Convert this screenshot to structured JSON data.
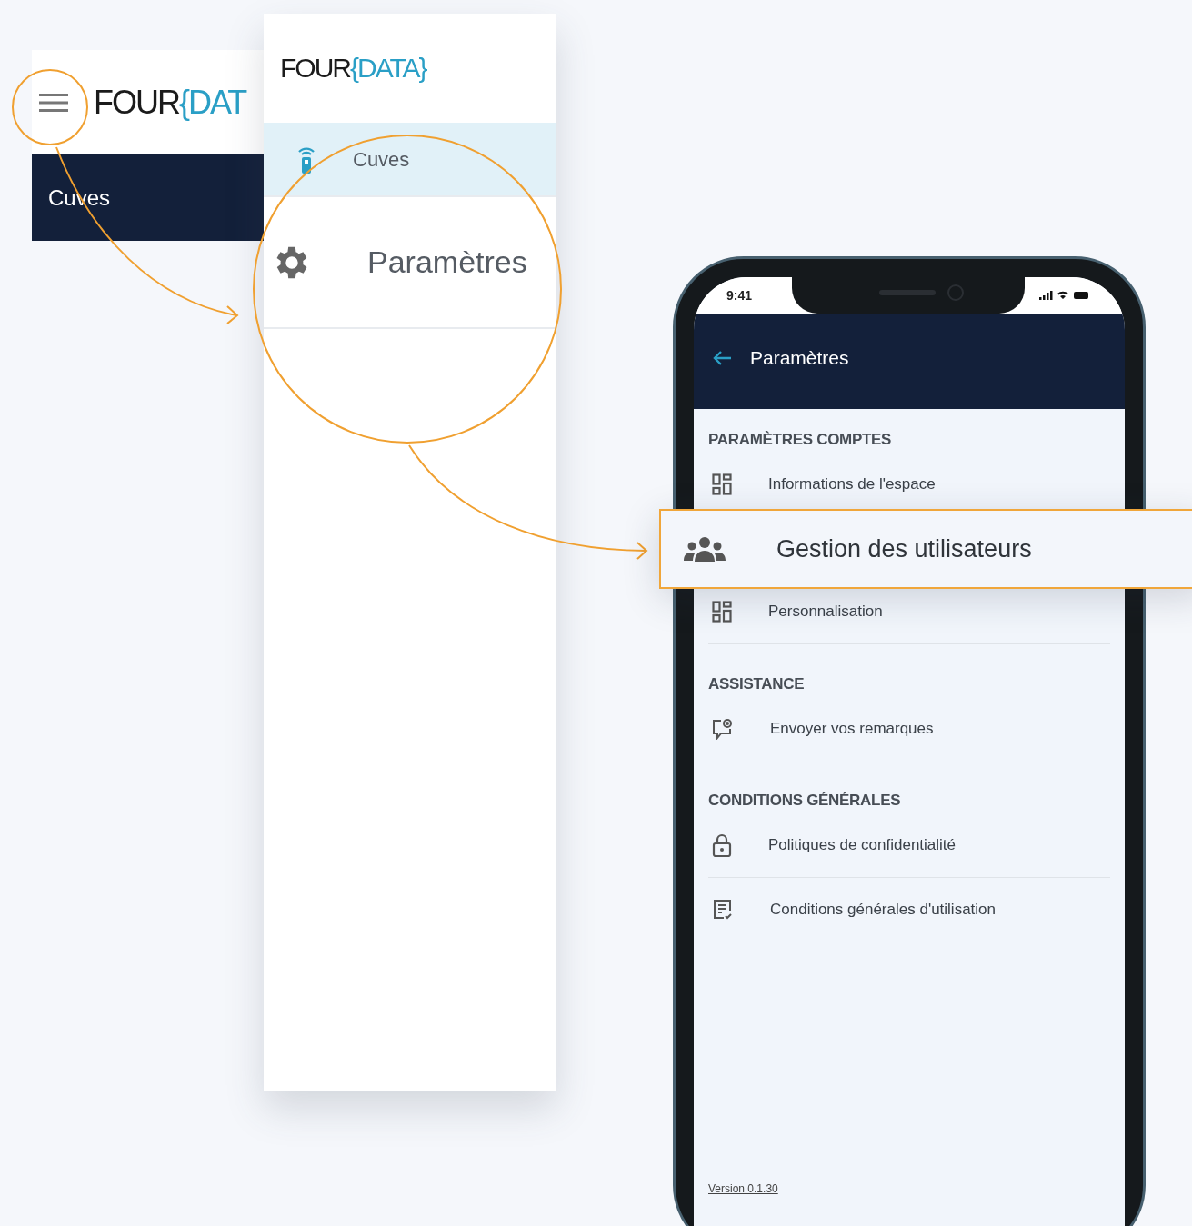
{
  "menu_panel": {
    "logo": {
      "word": "FOUR",
      "brace": "{DAT"
    },
    "nav_item": "Cuves"
  },
  "drawer": {
    "logo": {
      "word": "FOUR",
      "brace": "{DATA}"
    },
    "items": [
      {
        "label": "Cuves",
        "selected": true
      },
      {
        "label": "Paramètres",
        "selected": false
      }
    ]
  },
  "phone": {
    "status_bar": {
      "time": "9:41"
    },
    "header": {
      "title": "Paramètres"
    },
    "sections": [
      {
        "title": "PARAMÈTRES COMPTES",
        "items": [
          {
            "label": "Informations de l'espace",
            "highlighted": false,
            "divider": false
          },
          {
            "label": "Gestion des utilisateurs",
            "highlighted": true,
            "divider": false
          },
          {
            "label": "Personnalisation",
            "highlighted": false,
            "divider": true
          }
        ]
      },
      {
        "title": "ASSISTANCE",
        "items": [
          {
            "label": "Envoyer vos remarques",
            "highlighted": false,
            "divider": false
          }
        ]
      },
      {
        "title": "CONDITIONS GÉNÉRALES",
        "items": [
          {
            "label": "Politiques de confidentialité",
            "highlighted": false,
            "divider": true
          },
          {
            "label": "Conditions générales d'utilisation",
            "highlighted": false,
            "divider": false
          }
        ]
      }
    ],
    "version": "Version 0.1.30"
  }
}
